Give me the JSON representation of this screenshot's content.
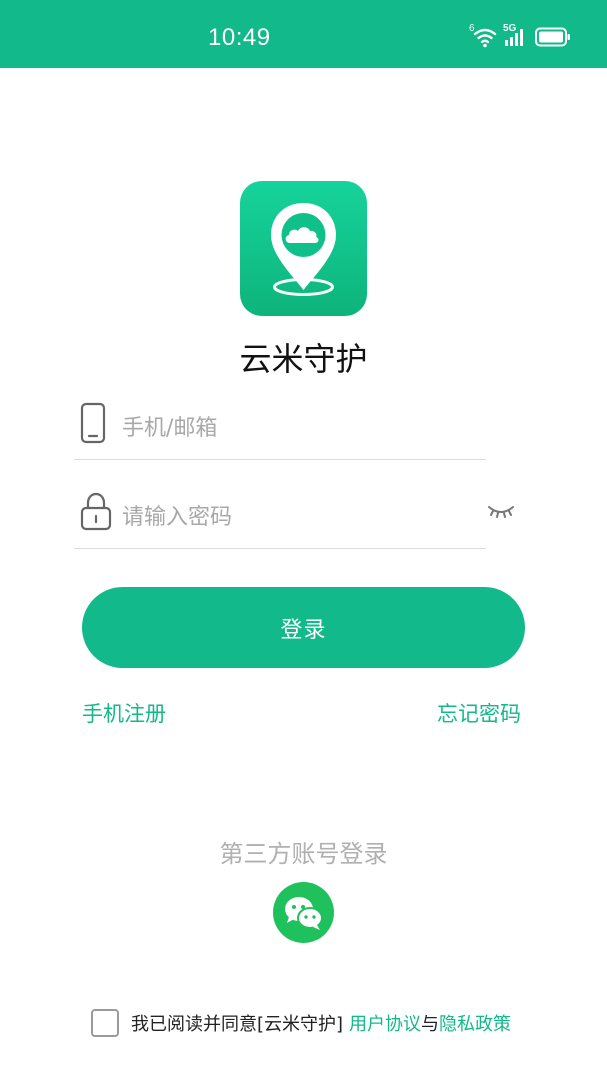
{
  "status_bar": {
    "time": "10:49",
    "wifi_badge": "6",
    "network": "5G",
    "icons": [
      "wifi-icon",
      "cellular-signal-icon",
      "battery-icon"
    ]
  },
  "app": {
    "name": "云米守护",
    "logo_icon": "location-pin-cloud-icon"
  },
  "login_form": {
    "account_placeholder": "手机/邮箱",
    "password_placeholder": "请输入密码",
    "login_label": "登录"
  },
  "links": {
    "register": "手机注册",
    "forgot_password": "忘记密码"
  },
  "third_party": {
    "title": "第三方账号登录",
    "wechat_icon": "wechat-icon"
  },
  "agreement": {
    "text": "我已阅读并同意[云米守护]",
    "user_agreement": "用户协议",
    "and": "与",
    "privacy_policy": "隐私政策"
  },
  "colors": {
    "primary": "#12b98a",
    "wechat": "#1fc15c",
    "placeholder": "#a8a8a8"
  }
}
